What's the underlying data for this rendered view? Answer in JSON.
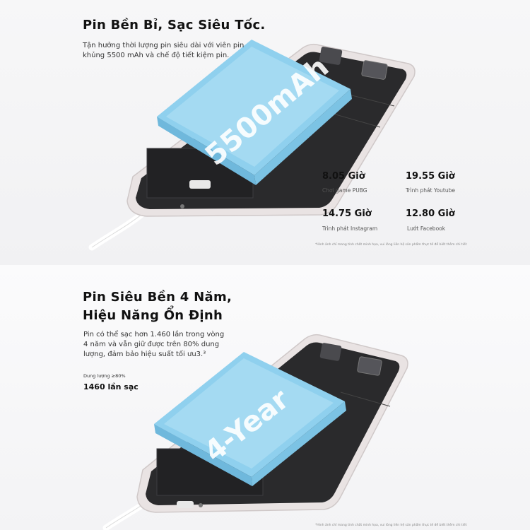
{
  "section1": {
    "title": "Pin Bền Bỉ, Sạc Siêu Tốc.",
    "description_lines": [
      "Tận hưởng thời lượng pin siêu dài với viên pin",
      "khủng 5500 mAh và chế độ tiết kiệm pin."
    ],
    "battery_label": "5500mAh",
    "stats": [
      {
        "value": "8.05 Giờ",
        "label": "Chơi game PUBG"
      },
      {
        "value": "19.55 Giờ",
        "label": "Trình phát Youtube"
      },
      {
        "value": "14.75 Giờ",
        "label": "Trình phát Instagram"
      },
      {
        "value": "12.80 Giờ",
        "label": "Lướt Facebook"
      }
    ],
    "footnote": "*Hình ảnh chỉ mang tính chất minh họa, vui lòng liên hệ sản phẩm thực tế để biết thêm chi tiết"
  },
  "section2": {
    "title_lines": [
      "Pin Siêu Bền 4 Năm,",
      "Hiệu Năng Ổn Định"
    ],
    "description_lines": [
      "Pin có thể sạc hơn 1.460 lần trong vòng",
      "4 năm và vẫn giữ được trên 80% dung",
      "lượng, đảm bảo hiệu suất tối ưu3.³"
    ],
    "capacity_label": "Dung lượng ≥80%",
    "charge_cycles": "1460 lần sạc",
    "battery_label": "4-Year",
    "footnote": "*Hình ảnh chỉ mang tính chất minh họa, vui lòng liên hệ sản phẩm thực tế để biết thêm chi tiết"
  },
  "colors": {
    "battery_blue": "#8fd0ee",
    "battery_blue_light": "#bfe6f7",
    "phone_frame": "#e9e3e3",
    "phone_inner": "#2a2a2c"
  }
}
